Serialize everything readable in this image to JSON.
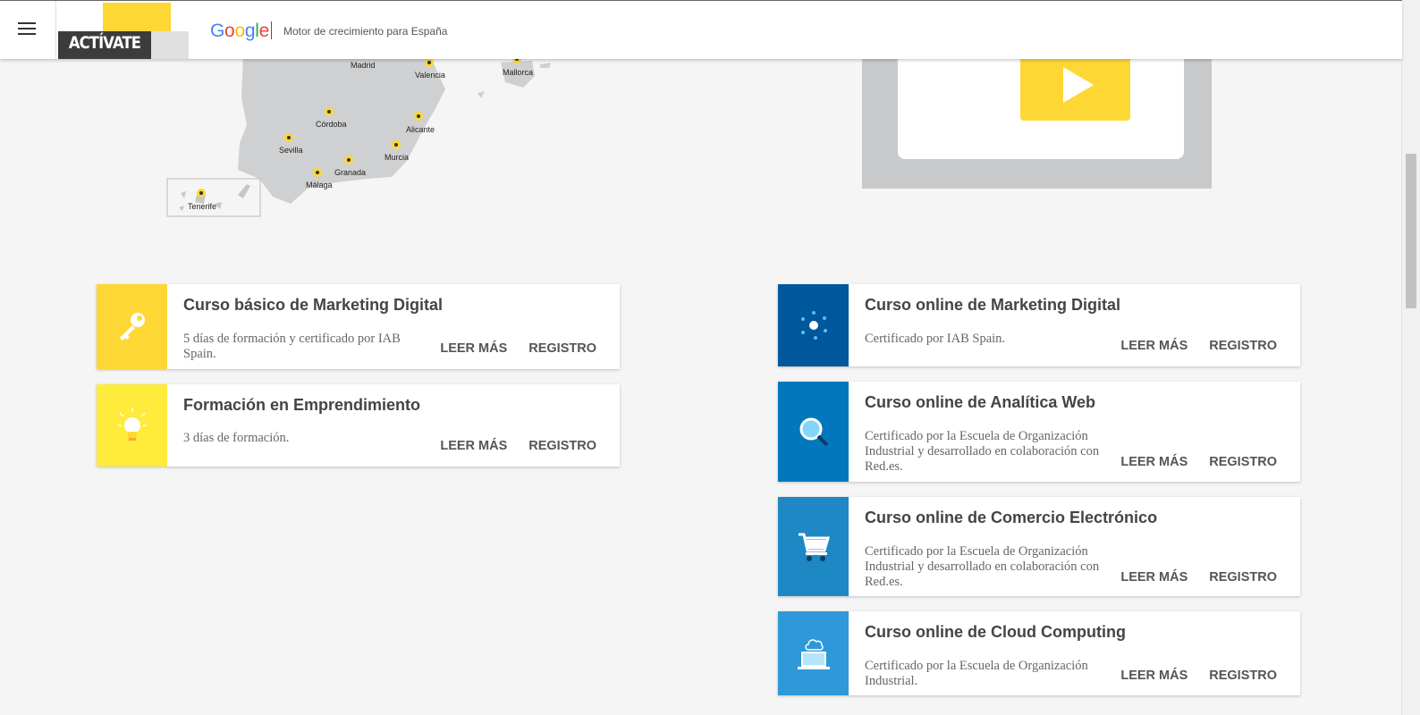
{
  "header": {
    "logo_text": "ACTÍVATE",
    "google": "Google",
    "tagline": "Motor de crecimiento para España"
  },
  "map": {
    "cities": [
      "Madrid",
      "Valencia",
      "Mallorca",
      "Córdoba",
      "Alicante",
      "Sevilla",
      "Murcia",
      "Granada",
      "Málaga",
      "Tenerife"
    ]
  },
  "colors": {
    "yellow": "#fdd835",
    "yellow_light": "#ffeb3b",
    "blue_dark": "#01579b",
    "blue_mid": "#0277bd",
    "blue": "#1e88c5",
    "blue_light": "#2f98d8"
  },
  "courses_left": [
    {
      "title": "Curso básico de Marketing Digital",
      "desc": "5 días de formación y certificado por IAB Spain.",
      "icon": "key-icon",
      "read_more": "LEER MÁS",
      "register": "REGISTRO"
    },
    {
      "title": "Formación en Emprendimiento",
      "desc": "3 días de formación.",
      "icon": "lightbulb-icon",
      "read_more": "LEER MÁS",
      "register": "REGISTRO"
    }
  ],
  "courses_right": [
    {
      "title": "Curso online de Marketing Digital",
      "desc": "Certificado por IAB Spain.",
      "icon": "network-dots-icon",
      "read_more": "LEER MÁS",
      "register": "REGISTRO"
    },
    {
      "title": "Curso online de Analítica Web",
      "desc": "Certificado por la Escuela de Organización Industrial y desarrollado en colaboración con Red.es.",
      "icon": "magnifier-icon",
      "read_more": "LEER MÁS",
      "register": "REGISTRO"
    },
    {
      "title": "Curso online de Comercio Electrónico",
      "desc": "Certificado por la Escuela de Organización Industrial y desarrollado en colaboración con Red.es.",
      "icon": "cart-icon",
      "read_more": "LEER MÁS",
      "register": "REGISTRO"
    },
    {
      "title": "Curso online de Cloud Computing",
      "desc": "Certificado por la Escuela de Organización Industrial.",
      "icon": "cloud-laptop-icon",
      "read_more": "LEER MÁS",
      "register": "REGISTRO"
    }
  ]
}
